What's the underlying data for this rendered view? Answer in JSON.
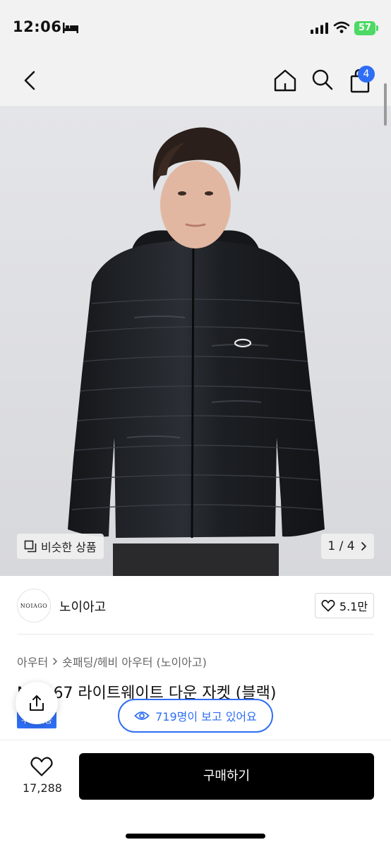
{
  "status_bar": {
    "time": "12:06",
    "battery": "57"
  },
  "nav": {
    "cart_count": "4"
  },
  "gallery": {
    "similar_label": "비슷한 상품",
    "page_counter": "1 / 4"
  },
  "shop": {
    "logo_text": "NOIAGO",
    "name": "노이아고",
    "likes": "5.1만"
  },
  "product": {
    "breadcrumb": [
      "아우터",
      "숏패딩/헤비 아우터 (노이아고)"
    ],
    "title": "N   1067 라이트웨이트 다운 자켓 (블랙)",
    "promo_tag": "무료배송"
  },
  "viewers": "719명이 보고 있어요",
  "bottom": {
    "wish_count": "17,288",
    "buy_label": "구매하기"
  },
  "colors": {
    "accent": "#2e6ef5",
    "buy_button": "#000000",
    "battery": "#4cd964"
  }
}
